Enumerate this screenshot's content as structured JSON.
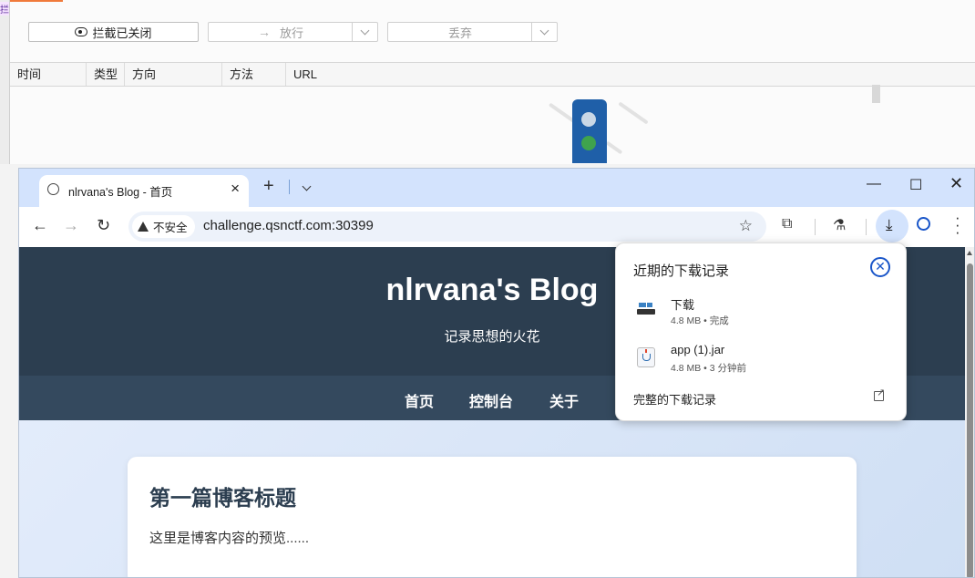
{
  "tool": {
    "left_tag": "拦",
    "intercept_button": "拦截已关闭",
    "forward_button": "放行",
    "drop_button": "丢弃",
    "columns": [
      "时间",
      "类型",
      "方向",
      "方法",
      "URL"
    ]
  },
  "browser": {
    "tab_title": "nlrvana's Blog - 首页",
    "security_label": "不安全",
    "url": "challenge.qsnctf.com:30399"
  },
  "page": {
    "site_title": "nlrvana's Blog",
    "site_subtitle": "记录思想的火花",
    "nav": [
      "首页",
      "控制台",
      "关于"
    ],
    "post_title": "第一篇博客标题",
    "post_preview": "这里是博客内容的预览......"
  },
  "downloads": {
    "title": "近期的下载记录",
    "items": [
      {
        "name": "下载",
        "meta": "4.8 MB • 完成",
        "icon": "installer-icon"
      },
      {
        "name": "app (1).jar",
        "meta": "4.8 MB • 3 分钟前",
        "icon": "java-jar-icon"
      }
    ],
    "full_history": "完整的下载记录"
  }
}
